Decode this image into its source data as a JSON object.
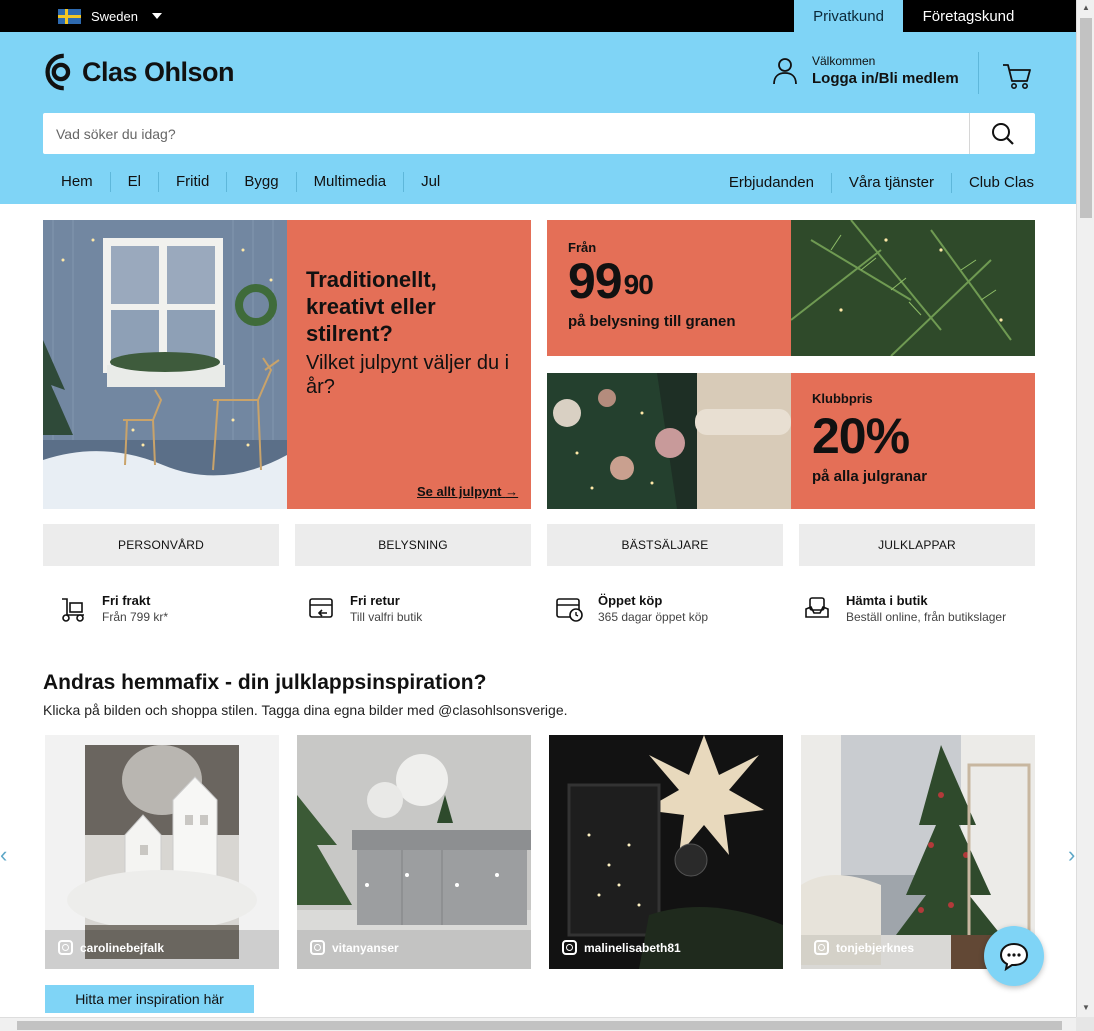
{
  "topbar": {
    "region": "Sweden",
    "tabs": [
      {
        "label": "Privatkund",
        "active": true
      },
      {
        "label": "Företagskund",
        "active": false
      }
    ]
  },
  "header": {
    "logo": "Clas Ohlson",
    "welcome": "Välkommen",
    "login": "Logga in/Bli medlem",
    "search_placeholder": "Vad söker du idag?",
    "nav_left": [
      "Hem",
      "El",
      "Fritid",
      "Bygg",
      "Multimedia",
      "Jul"
    ],
    "nav_right": [
      "Erbjudanden",
      "Våra tjänster",
      "Club Clas"
    ]
  },
  "hero": {
    "headline": "Traditionellt, kreativt eller stilrent?",
    "sub": "Vilket julpynt väljer du i år?",
    "link": "Se allt julpynt"
  },
  "promos": [
    {
      "small": "Från",
      "price_main": "99",
      "price_dec": "90",
      "desc": "på belysning till granen"
    },
    {
      "small": "Klubbpris",
      "price_main": "20%",
      "desc": "på alla julgranar"
    }
  ],
  "categories": [
    "PERSONVÅRD",
    "BELYSNING",
    "BÄSTSÄLJARE",
    "JULKLAPPAR"
  ],
  "usps": [
    {
      "title": "Fri frakt",
      "sub": "Från 799 kr*"
    },
    {
      "title": "Fri retur",
      "sub": "Till valfri butik"
    },
    {
      "title": "Öppet köp",
      "sub": "365 dagar öppet köp"
    },
    {
      "title": "Hämta i butik",
      "sub": "Beställ online, från butikslager"
    }
  ],
  "inspiration": {
    "title": "Andras hemmafix - din julklappsinspiration?",
    "subtitle": "Klicka på bilden och shoppa stilen. Tagga dina egna bilder med @clasohlsonsverige.",
    "users": [
      "carolinebejfalk",
      "vitanyanser",
      "malinelisabeth81",
      "tonjebjerknes"
    ],
    "button": "Hitta mer inspiration här"
  },
  "colors": {
    "brand_blue": "#7fd4f6",
    "promo_orange": "#e46f57"
  }
}
